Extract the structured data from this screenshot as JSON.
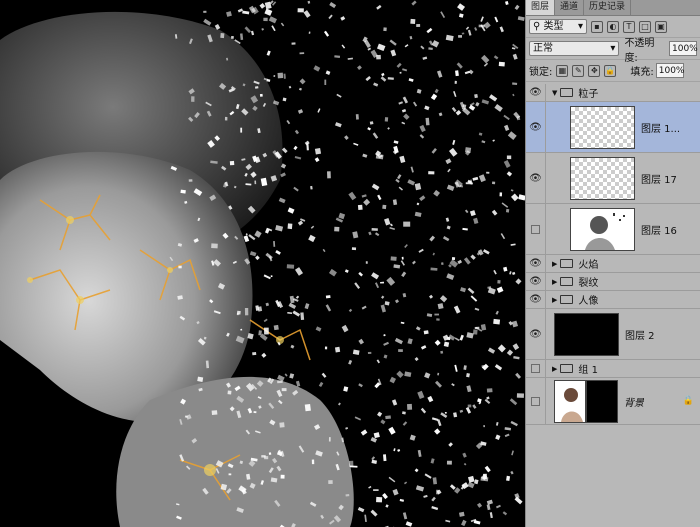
{
  "panel": {
    "tabs": [
      "图层",
      "通道",
      "历史记录"
    ],
    "filter": {
      "label": "类型"
    },
    "filter_icons": [
      "image-filter-icon",
      "adjustment-filter-icon",
      "text-filter-icon",
      "shape-filter-icon",
      "smart-object-filter-icon"
    ],
    "blend_mode": "正常",
    "opacity_label": "不透明度:",
    "opacity_value": "100%",
    "lock_label": "锁定:",
    "fill_label": "填充:",
    "fill_value": "100%",
    "text_icon": "T"
  },
  "layers": [
    {
      "name": "粒子",
      "type": "group",
      "expanded": true,
      "visible": true
    },
    {
      "name": "图层 1...",
      "type": "layer",
      "visible": true,
      "selected": true
    },
    {
      "name": "图层 17",
      "type": "layer",
      "visible": true
    },
    {
      "name": "图层 16",
      "type": "layer",
      "visible": false
    },
    {
      "name": "火焰",
      "type": "group",
      "visible": true
    },
    {
      "name": "裂纹",
      "type": "group",
      "visible": true
    },
    {
      "name": "人像",
      "type": "group",
      "visible": true
    },
    {
      "name": "图层 2",
      "type": "layer",
      "visible": true
    },
    {
      "name": "组 1",
      "type": "group",
      "visible": false
    },
    {
      "name": "背景",
      "type": "background",
      "visible": false,
      "locked": true
    }
  ],
  "colors": {
    "panel_bg": "#b8b8b8",
    "selected_bg": "#a4b6da",
    "canvas_bg": "#000000",
    "crack_glow": "#e8a030"
  }
}
